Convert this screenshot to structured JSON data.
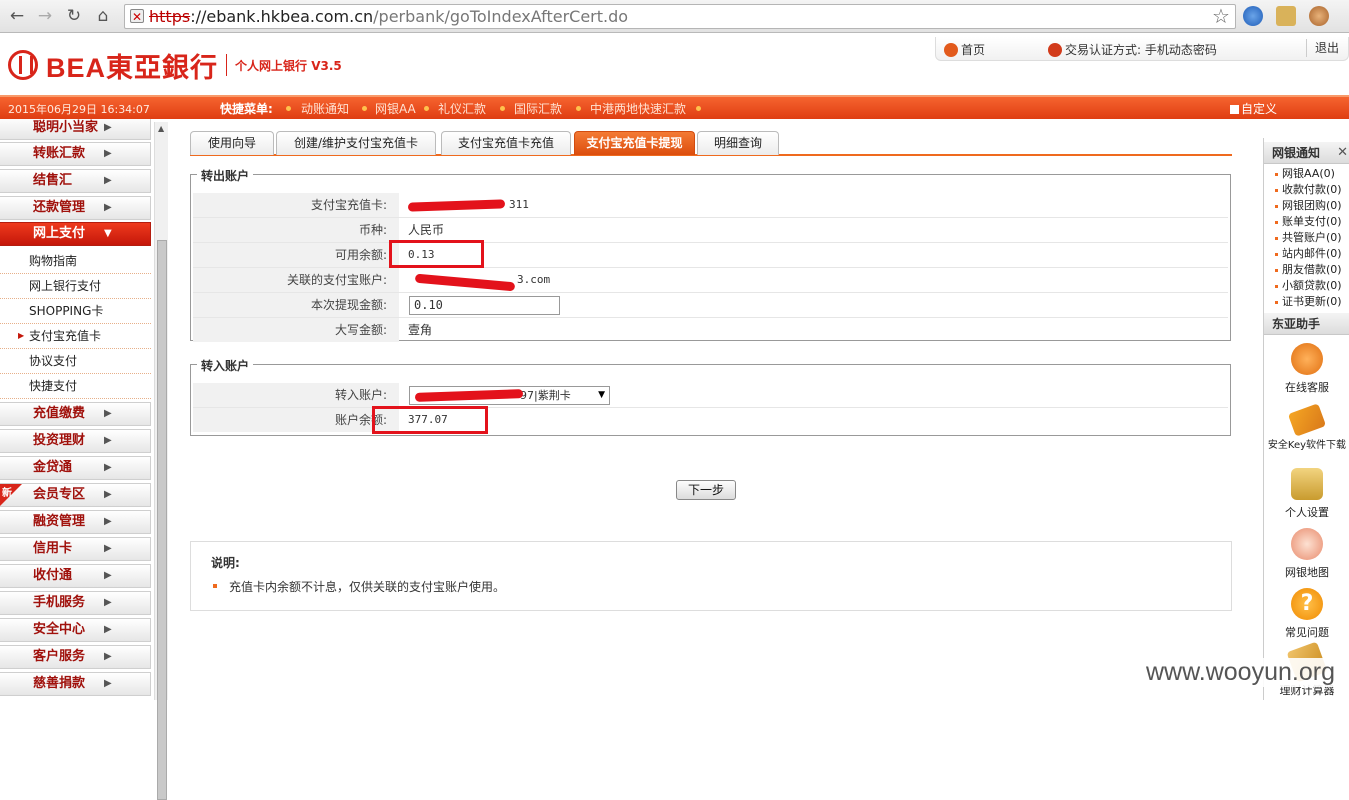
{
  "browser": {
    "url_scheme": "https",
    "url_host": "://ebank.hkbea.com.cn",
    "url_path": "/perbank/goToIndexAfterCert.do"
  },
  "header": {
    "bank_name": "BEA東亞銀行",
    "product": "个人网上银行 V3.5",
    "home_label": "首页",
    "auth_label": "交易认证方式: 手机动态密码",
    "logout_label": "退出"
  },
  "toolbar": {
    "datetime": "2015年06月29日 16:34:07",
    "quick_label": "快捷菜单:",
    "quick_items": [
      "动账通知",
      "网银AA",
      "礼仪汇款",
      "国际汇款",
      "中港两地快速汇款"
    ],
    "custom_label": "自定义"
  },
  "sidebar": {
    "menu_top": [
      "聪明小当家",
      "转账汇款",
      "结售汇",
      "还款管理"
    ],
    "active_menu": "网上支付",
    "sub_items": [
      "购物指南",
      "网上银行支付",
      "SHOPPING卡",
      "支付宝充值卡",
      "协议支付",
      "快捷支付"
    ],
    "menu_bottom": [
      "充值缴费",
      "投资理财",
      "金贷通",
      "会员专区",
      "融资管理",
      "信用卡",
      "收付通",
      "手机服务",
      "安全中心",
      "客户服务",
      "慈善捐款"
    ],
    "new_badge": "新"
  },
  "tabs": [
    "使用向导",
    "创建/维护支付宝充值卡",
    "支付宝充值卡充值",
    "支付宝充值卡提现",
    "明细查询"
  ],
  "out_account": {
    "legend": "转出账户",
    "rows": [
      {
        "label": "支付宝充值卡:",
        "value": "311"
      },
      {
        "label": "币种:",
        "value": "人民币"
      },
      {
        "label": "可用余额:",
        "value": "0.13"
      },
      {
        "label": "关联的支付宝账户:",
        "value": "3.com"
      },
      {
        "label": "本次提现金额:",
        "value": "0.10"
      },
      {
        "label": "大写金额:",
        "value": "壹角"
      }
    ]
  },
  "in_account": {
    "legend": "转入账户",
    "rows": [
      {
        "label": "转入账户:",
        "value": "97|紫荆卡"
      },
      {
        "label": "账户余额:",
        "value": "377.07"
      }
    ]
  },
  "next_button": "下一步",
  "note": {
    "title": "说明:",
    "text": "充值卡内余额不计息，仅供关联的支付宝账户使用。"
  },
  "right_panel": {
    "notice_title": "网银通知",
    "notice_items": [
      "网银AA(0)",
      "收款付款(0)",
      "网银团购(0)",
      "账单支付(0)",
      "共管账户(0)",
      "站内邮件(0)",
      "朋友借款(0)",
      "小额贷款(0)",
      "证书更新(0)"
    ],
    "helper_title": "东亚助手",
    "helpers": [
      "在线客服",
      "安全Key软件下载",
      "个人设置",
      "网银地图",
      "常见问题",
      "理财计算器"
    ]
  },
  "watermark": "www.wooyun.org",
  "colors": {
    "brand_red": "#d8251a",
    "orange_bar": "#ef5a23",
    "redaction": "#e3121b"
  }
}
